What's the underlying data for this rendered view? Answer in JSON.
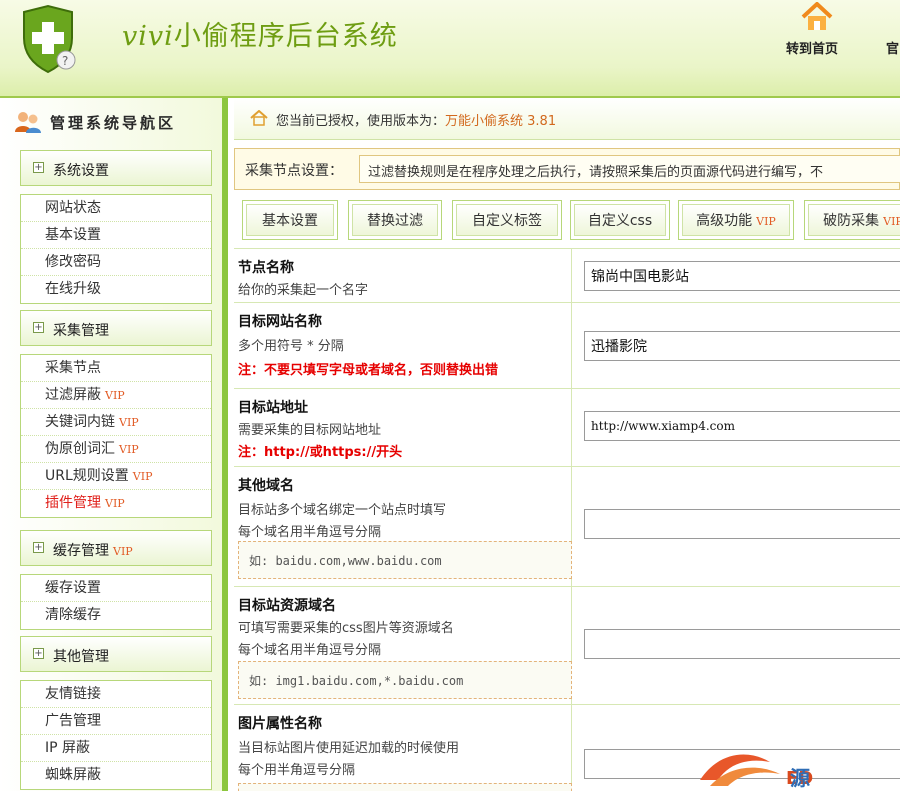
{
  "header": {
    "title_latin": "vivi",
    "title_cn": "小偷程序后台系统",
    "home_link": "转到首页",
    "site_link": "官"
  },
  "sidebar": {
    "title": "管理系统导航区",
    "groups": [
      {
        "label": "系统设置",
        "vip": "",
        "items": [
          {
            "label": "网站状态",
            "vip": ""
          },
          {
            "label": "基本设置",
            "vip": ""
          },
          {
            "label": "修改密码",
            "vip": ""
          },
          {
            "label": "在线升级",
            "vip": ""
          }
        ]
      },
      {
        "label": "采集管理",
        "vip": "",
        "items": [
          {
            "label": "采集节点",
            "vip": ""
          },
          {
            "label": "过滤屏蔽",
            "vip": "VIP"
          },
          {
            "label": "关键词内链",
            "vip": "VIP"
          },
          {
            "label": "伪原创词汇",
            "vip": "VIP"
          },
          {
            "label": "URL规则设置",
            "vip": "VIP"
          },
          {
            "label": "插件管理",
            "vip": "VIP",
            "active": true
          }
        ]
      },
      {
        "label": "缓存管理",
        "vip": "VIP",
        "items": [
          {
            "label": "缓存设置",
            "vip": ""
          },
          {
            "label": "清除缓存",
            "vip": ""
          }
        ]
      },
      {
        "label": "其他管理",
        "vip": "",
        "items": [
          {
            "label": "友情链接",
            "vip": ""
          },
          {
            "label": "广告管理",
            "vip": ""
          },
          {
            "label": "IP 屏蔽",
            "vip": ""
          },
          {
            "label": "蜘蛛屏蔽",
            "vip": ""
          }
        ]
      }
    ]
  },
  "status": {
    "text": "您当前已授权，使用版本为：",
    "version": "万能小偷系统 3.81"
  },
  "node_settings": {
    "label": "采集节点设置：",
    "note": "过滤替换规则是在程序处理之后执行，请按照采集后的页面源代码进行编写，不"
  },
  "tabs": [
    {
      "label": "基本设置",
      "vip": ""
    },
    {
      "label": "替换过滤",
      "vip": ""
    },
    {
      "label": "自定义标签",
      "vip": ""
    },
    {
      "label": "自定义css",
      "vip": ""
    },
    {
      "label": "高级功能",
      "vip": "VIP"
    },
    {
      "label": "破防采集",
      "vip": "VIP"
    }
  ],
  "form": {
    "node_name": {
      "title": "节点名称",
      "desc": "给你的采集起一个名字",
      "value": "锦尚中国电影站"
    },
    "target_name": {
      "title": "目标网站名称",
      "desc": "多个用符号 * 分隔",
      "warn": "注：不要只填写字母或者域名，否则替换出错",
      "value": "迅播影院"
    },
    "target_url": {
      "title": "目标站地址",
      "desc": "需要采集的目标网站地址",
      "warn": "注：http://或https://开头",
      "value": "http://www.xiamp4.com"
    },
    "other_domains": {
      "title": "其他域名",
      "desc1": "目标站多个域名绑定一个站点时填写",
      "desc2": "每个域名用半角逗号分隔",
      "example": "如: baidu.com,www.baidu.com",
      "value": ""
    },
    "resource_domains": {
      "title": "目标站资源域名",
      "desc1": "可填写需要采集的css图片等资源域名",
      "desc2": "每个域名用半角逗号分隔",
      "example": "如: img1.baidu.com,*.baidu.com",
      "value": ""
    },
    "img_attr": {
      "title": "图片属性名称",
      "desc1": "当目标站图片使用延迟加载的时候使用",
      "desc2": "每个用半角逗号分隔",
      "value": ""
    }
  },
  "watermark": {
    "text": "源"
  }
}
